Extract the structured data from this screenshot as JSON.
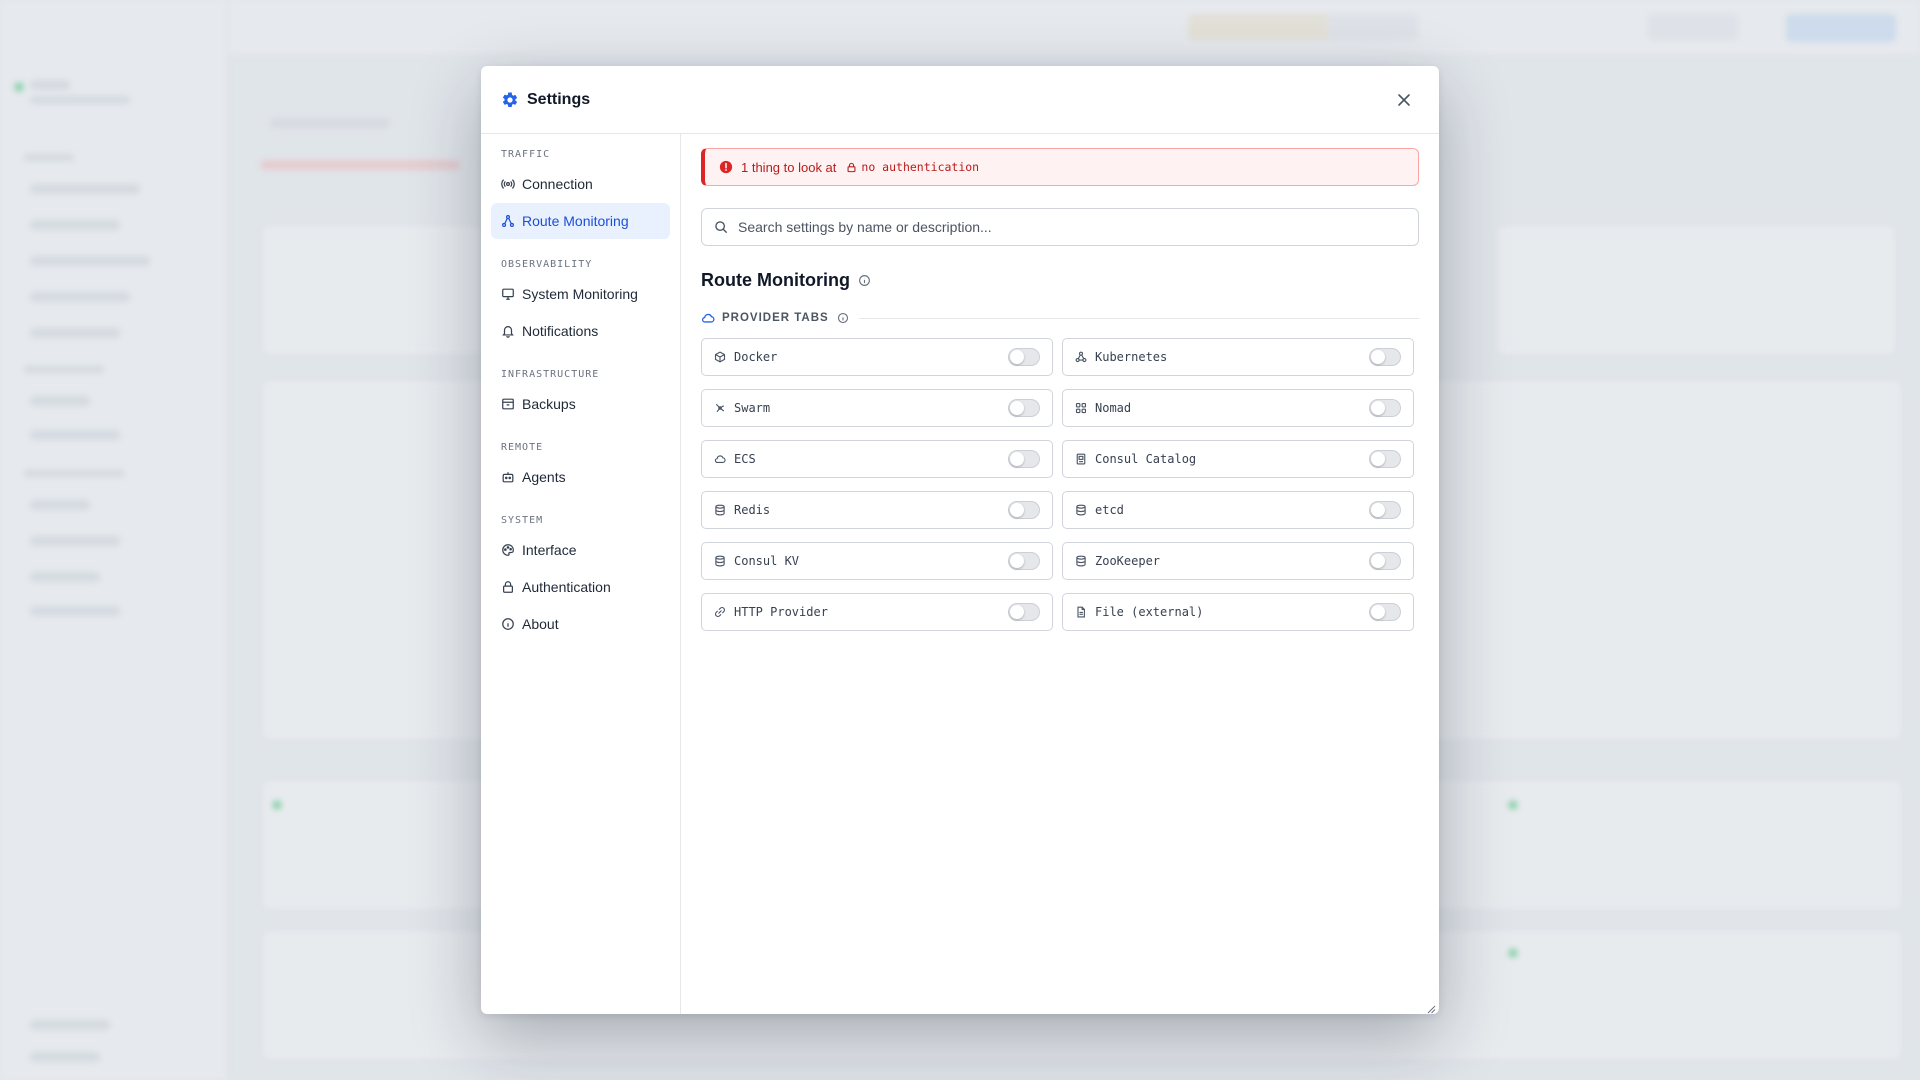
{
  "modal": {
    "title": "Settings",
    "close_icon": "close-icon"
  },
  "nav": {
    "sections": [
      {
        "label": "TRAFFIC",
        "items": [
          {
            "label": "Connection",
            "icon": "antenna-icon"
          },
          {
            "label": "Route Monitoring",
            "icon": "route-icon",
            "active": true
          }
        ]
      },
      {
        "label": "OBSERVABILITY",
        "items": [
          {
            "label": "System Monitoring",
            "icon": "monitor-icon"
          },
          {
            "label": "Notifications",
            "icon": "bell-icon"
          }
        ]
      },
      {
        "label": "INFRASTRUCTURE",
        "items": [
          {
            "label": "Backups",
            "icon": "archive-icon"
          }
        ]
      },
      {
        "label": "REMOTE",
        "items": [
          {
            "label": "Agents",
            "icon": "robot-icon"
          }
        ]
      },
      {
        "label": "SYSTEM",
        "items": [
          {
            "label": "Interface",
            "icon": "palette-icon"
          },
          {
            "label": "Authentication",
            "icon": "lock-icon"
          },
          {
            "label": "About",
            "icon": "info-icon"
          }
        ]
      }
    ]
  },
  "alert": {
    "text": "1 thing to look at",
    "tag": "no authentication",
    "color": "#dc2626"
  },
  "search": {
    "placeholder": "Search settings by name or description..."
  },
  "section": {
    "title": "Route Monitoring",
    "group_label": "PROVIDER TABS"
  },
  "providers": [
    {
      "label": "Docker",
      "icon": "box-icon",
      "enabled": false
    },
    {
      "label": "Kubernetes",
      "icon": "network-icon",
      "enabled": false
    },
    {
      "label": "Swarm",
      "icon": "swarm-icon",
      "enabled": false
    },
    {
      "label": "Nomad",
      "icon": "grid-icon",
      "enabled": false
    },
    {
      "label": "ECS",
      "icon": "cloud-icon",
      "enabled": false
    },
    {
      "label": "Consul Catalog",
      "icon": "catalog-icon",
      "enabled": false
    },
    {
      "label": "Redis",
      "icon": "database-icon",
      "enabled": false
    },
    {
      "label": "etcd",
      "icon": "database-icon",
      "enabled": false
    },
    {
      "label": "Consul KV",
      "icon": "database-icon",
      "enabled": false
    },
    {
      "label": "ZooKeeper",
      "icon": "database-icon",
      "enabled": false
    },
    {
      "label": "HTTP Provider",
      "icon": "link-icon",
      "enabled": false
    },
    {
      "label": "File (external)",
      "icon": "file-icon",
      "enabled": false
    }
  ],
  "colors": {
    "accent": "#1d4ed8",
    "active_nav_bg": "#e8f1fd",
    "danger": "#dc2626"
  }
}
